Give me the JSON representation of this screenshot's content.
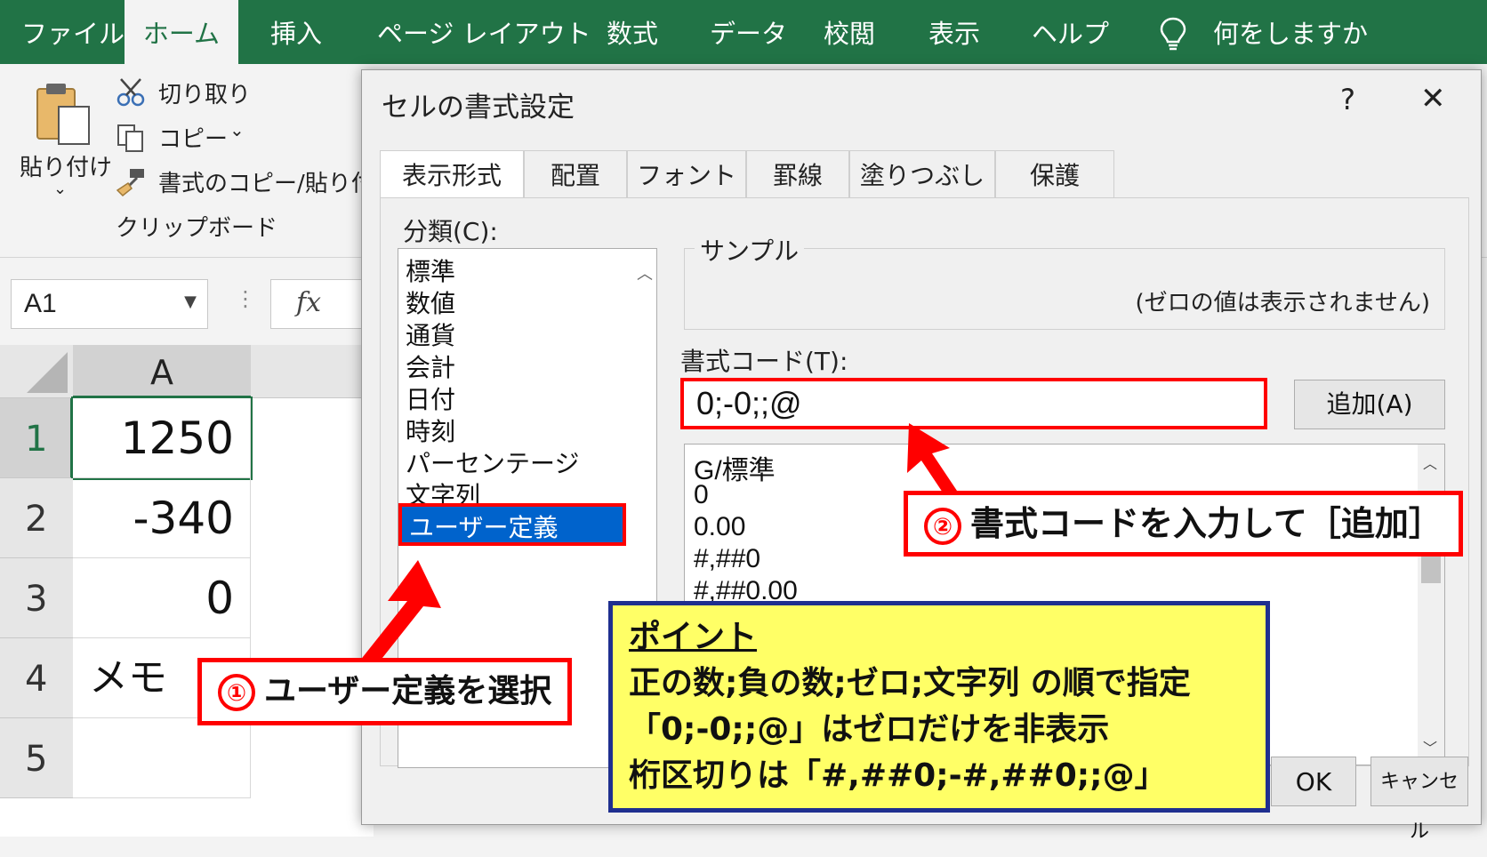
{
  "ribbon": {
    "tabs": [
      "ファイル",
      "ホーム",
      "挿入",
      "ページ レイアウト",
      "数式",
      "データ",
      "校閲",
      "表示",
      "ヘルプ"
    ],
    "active_tab": "ホーム",
    "tell_me": "何をしますか",
    "clipboard": {
      "paste": "貼り付け",
      "cut": "切り取り",
      "copy": "コピー",
      "format_painter": "書式のコピー/貼り付け",
      "group_label": "クリップボード"
    }
  },
  "formula_bar": {
    "name_box": "A1",
    "fx": "fx"
  },
  "sheet": {
    "column": "A",
    "rows": [
      {
        "num": "1",
        "value": "1250"
      },
      {
        "num": "2",
        "value": "-340"
      },
      {
        "num": "3",
        "value": "0"
      },
      {
        "num": "4",
        "value": "メモ"
      },
      {
        "num": "5",
        "value": ""
      }
    ]
  },
  "dialog": {
    "title": "セルの書式設定",
    "help": "?",
    "close": "✕",
    "tabs": [
      "表示形式",
      "配置",
      "フォント",
      "罫線",
      "塗りつぶし",
      "保護"
    ],
    "active_tab": "表示形式",
    "category_label": "分類(C):",
    "categories": [
      "標準",
      "数値",
      "通貨",
      "会計",
      "日付",
      "時刻",
      "パーセンテージ",
      "文字列",
      "ユーザー定義"
    ],
    "selected_category": "ユーザー定義",
    "sample_label": "サンプル",
    "sample_value": "(ゼロの値は表示されません)",
    "code_label": "書式コード(T):",
    "code_value": "0;-0;;@",
    "add_button": "追加(A)",
    "format_list": [
      "G/標準",
      "0",
      "0.00",
      "#,##0",
      "#,##0.00"
    ],
    "ok": "OK",
    "cancel": "キャンセル"
  },
  "callouts": {
    "step1_num": "①",
    "step1": "ユーザー定義を選択",
    "step2_num": "②",
    "step2": "書式コードを入力して［追加］"
  },
  "point_box": {
    "title": "ポイント",
    "line1": "正の数;負の数;ゼロ;文字列 の順で指定",
    "line2": "「0;-0;;@」はゼロだけを非表示",
    "line3": "桁区切りは「#,##0;-#,##0;;@」"
  },
  "colors": {
    "excel_green": "#217346",
    "highlight_red": "#ff0000",
    "selection_blue": "#0063cc",
    "point_yellow": "#ffff66",
    "point_border": "#1f2f8f"
  }
}
